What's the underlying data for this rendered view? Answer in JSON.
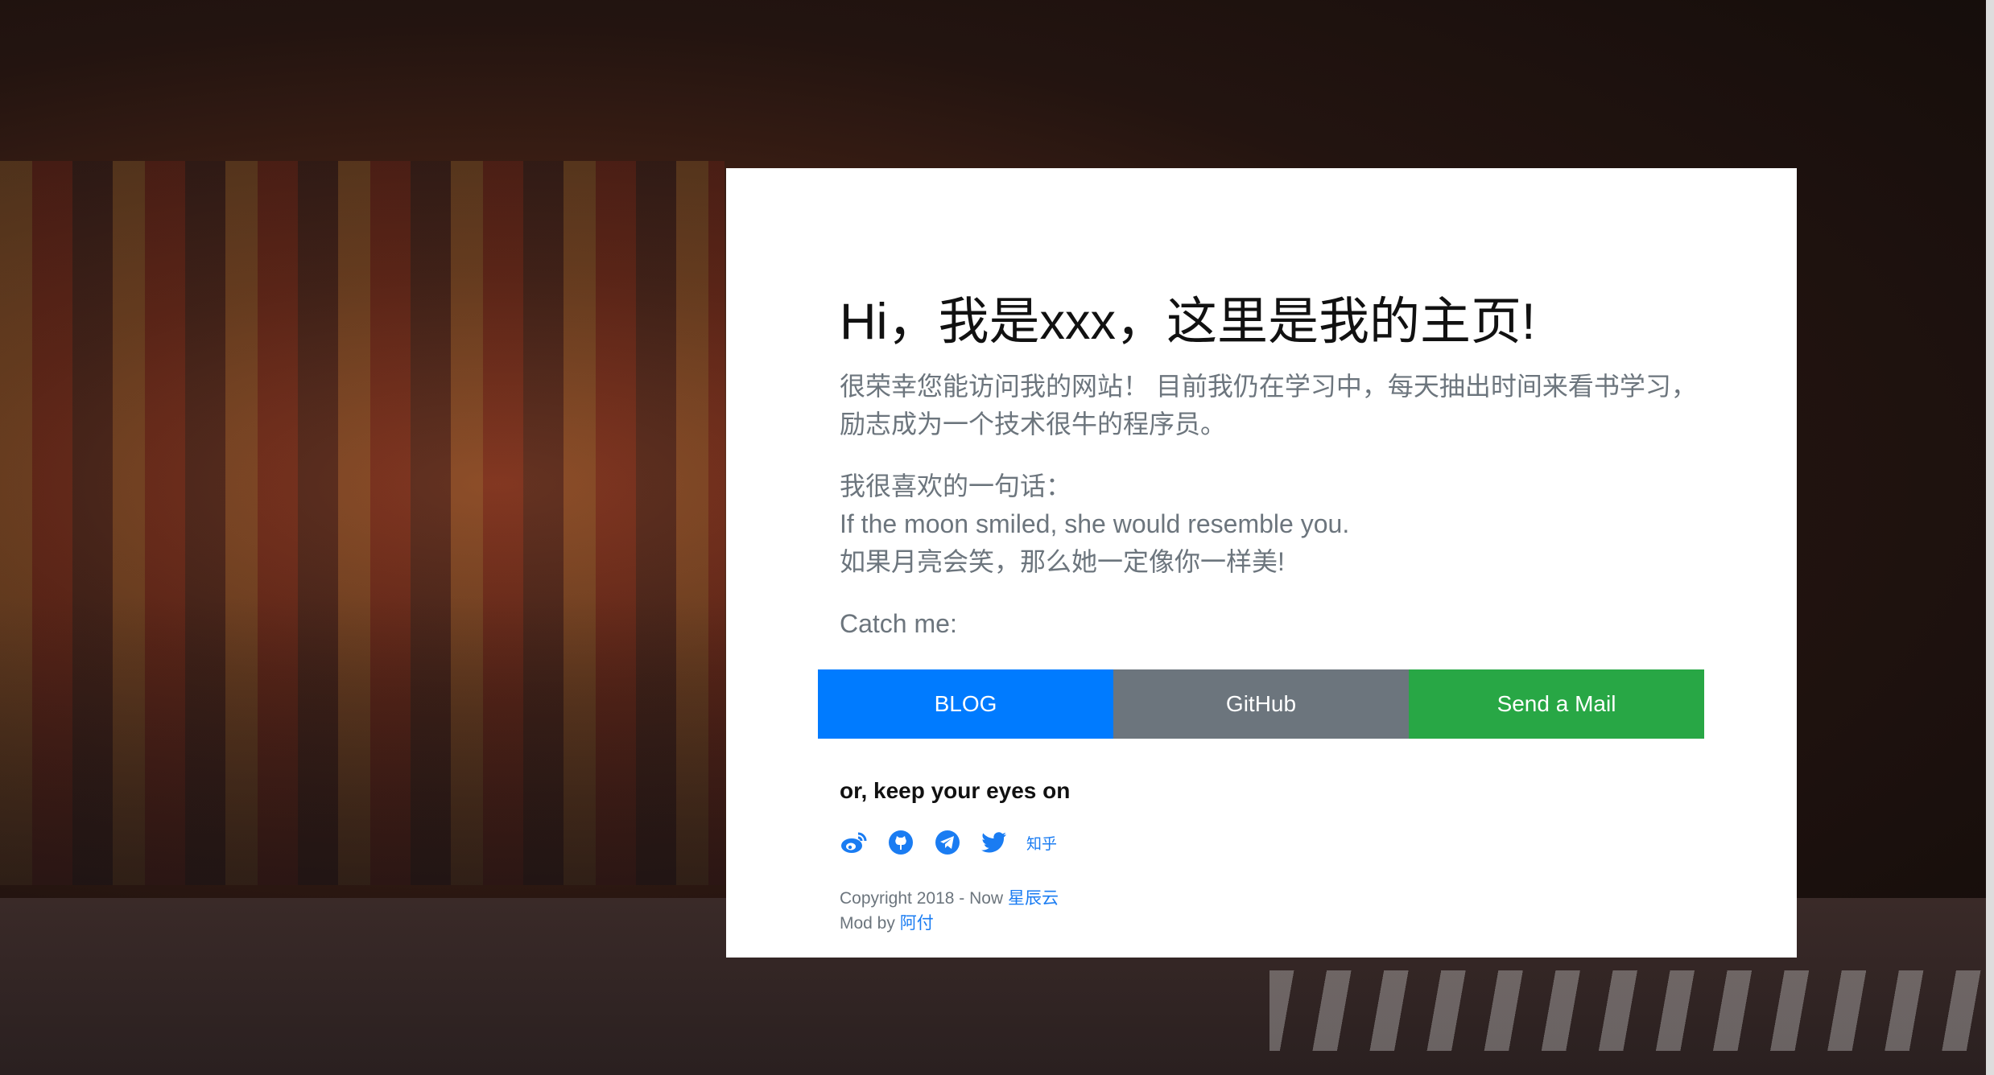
{
  "card": {
    "title": "Hi，我是xxx，这里是我的主页!",
    "intro_line1": "很荣幸您能访问我的网站！ 目前我仍在学习中，每天抽出时间来看书学习，",
    "intro_line2": "励志成为一个技术很牛的程序员。",
    "quote_label": "我很喜欢的一句话：",
    "quote_en": "If the moon smiled, she would resemble you.",
    "quote_zh": "如果月亮会笑，那么她一定像你一样美!",
    "catch_me": "Catch me:",
    "buttons": [
      {
        "label": "BLOG",
        "color": "#007bff"
      },
      {
        "label": "GitHub",
        "color": "#6c757d"
      },
      {
        "label": "Send a Mail",
        "color": "#28a745"
      }
    ],
    "eyes_on": "or, keep your eyes on",
    "social": [
      "weibo-icon",
      "github-icon",
      "telegram-icon",
      "twitter-icon"
    ],
    "zhihu": "知乎",
    "copyright": "Copyright 2018 - Now",
    "copyright_link": "星辰云",
    "mod_by": "Mod by",
    "mod_link": "阿付"
  },
  "colors": {
    "accent": "#1a7cf2"
  }
}
